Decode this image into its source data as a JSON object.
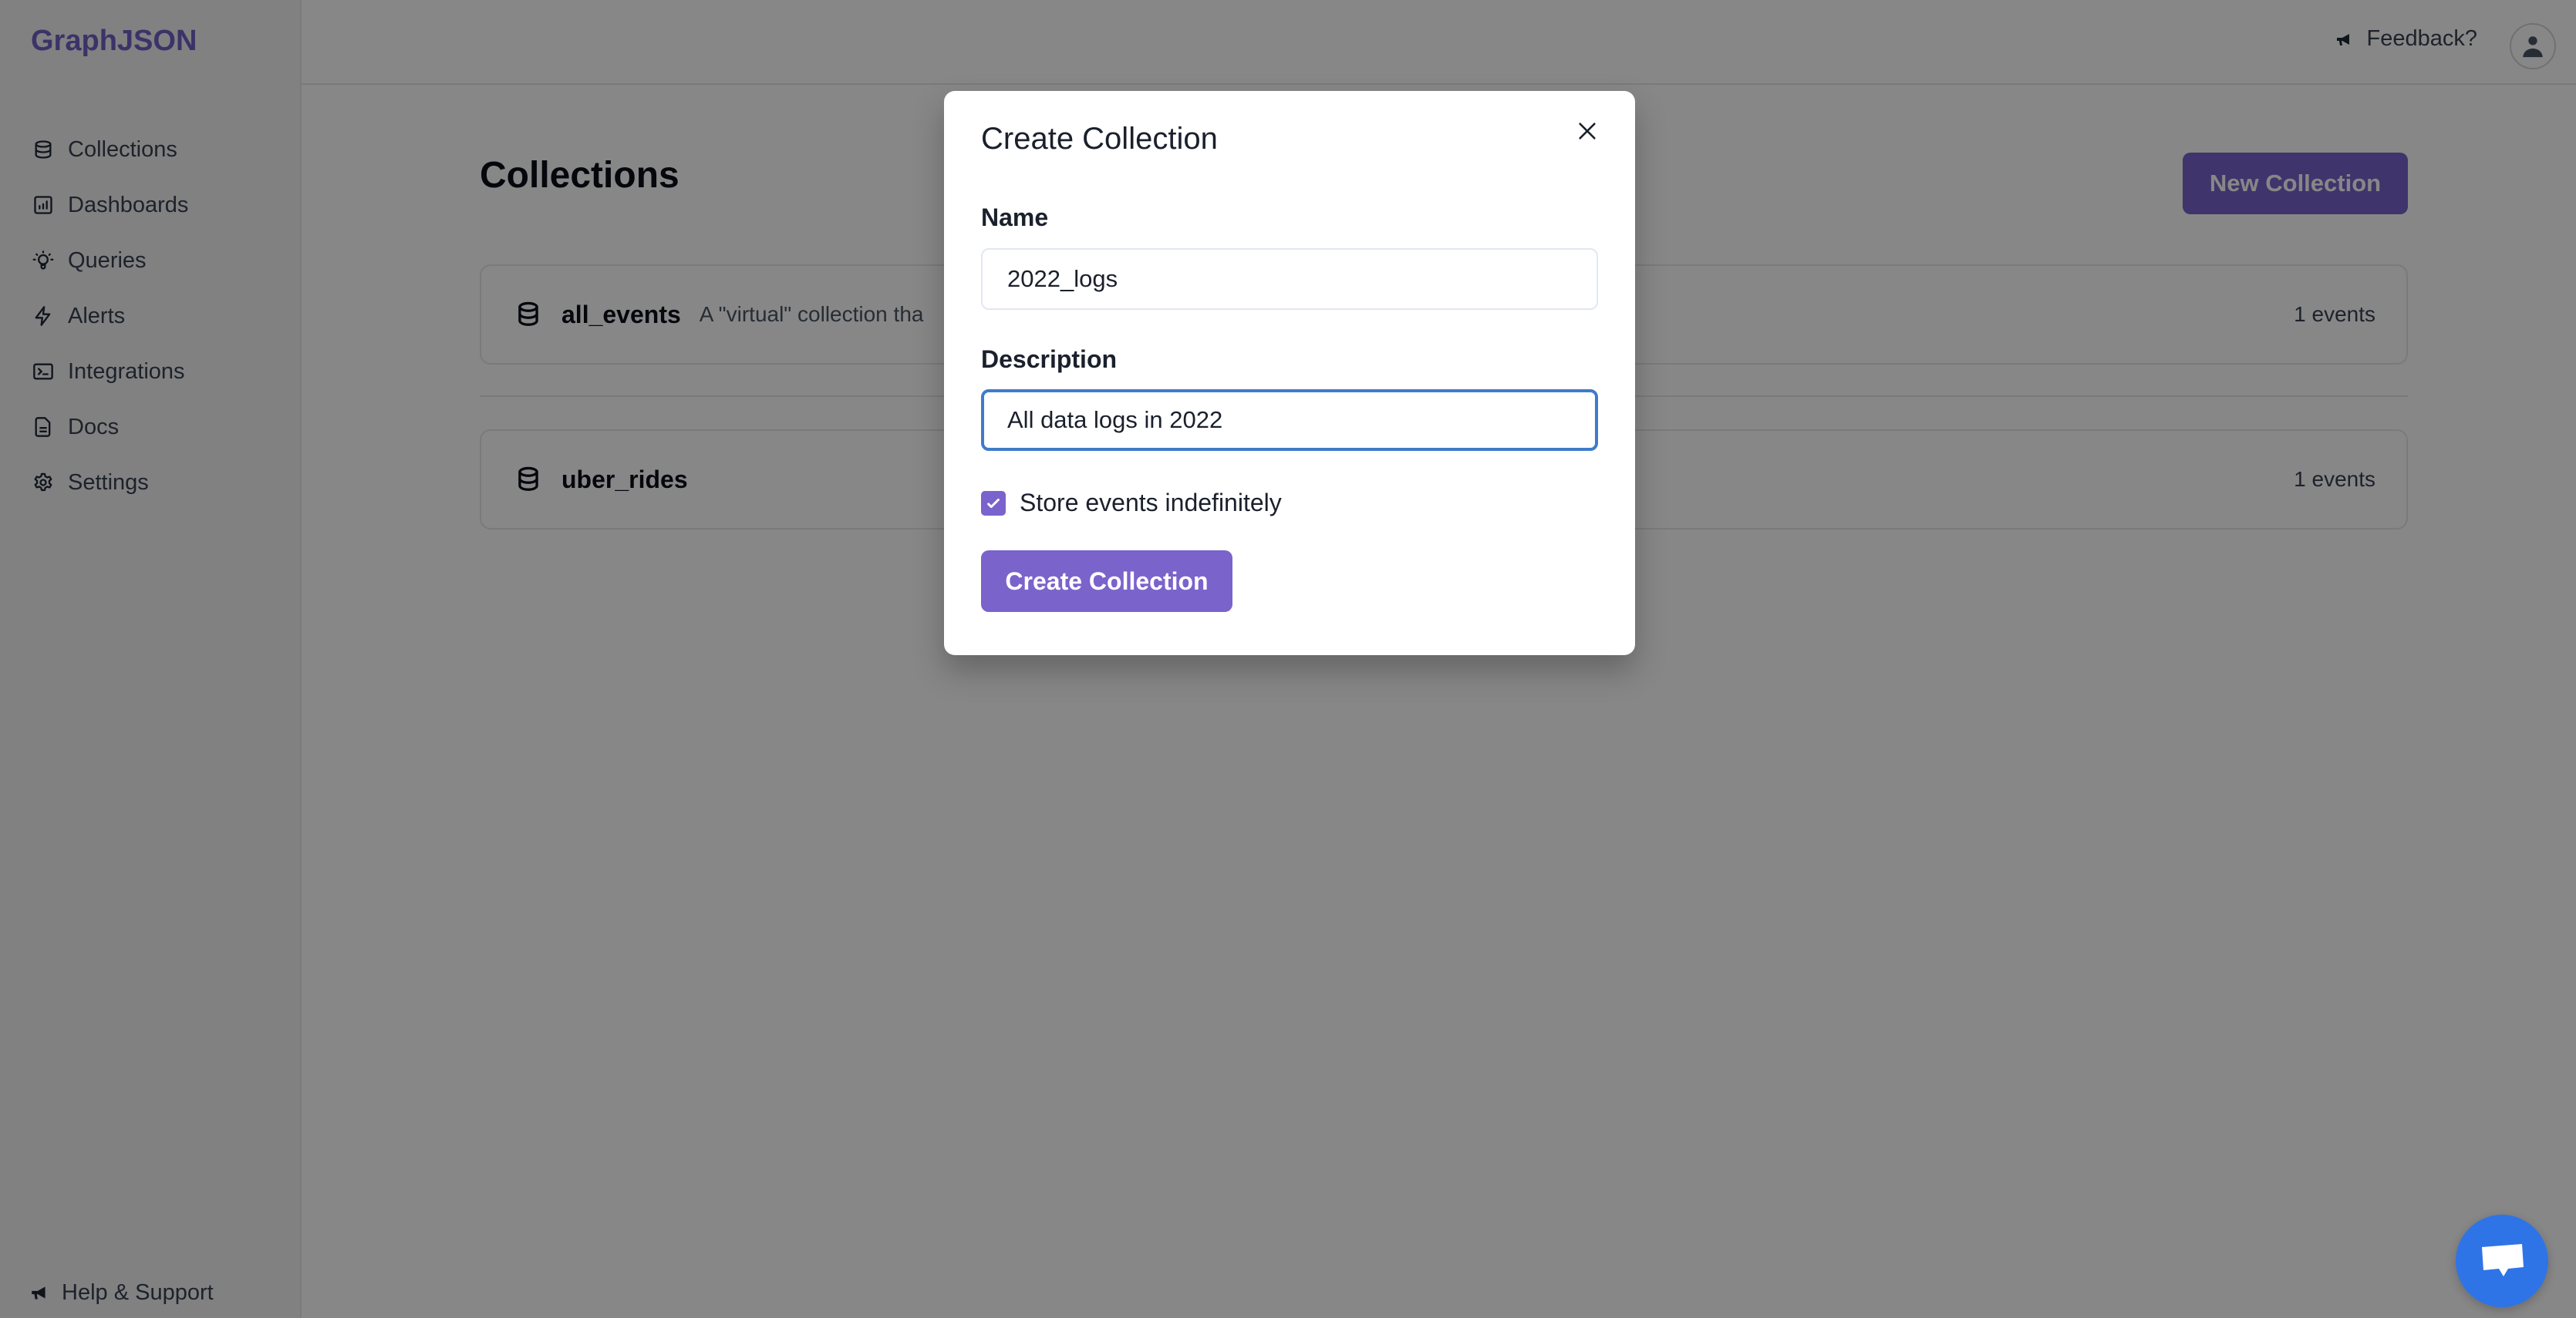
{
  "app": {
    "logo": "GraphJSON"
  },
  "sidebar": {
    "items": [
      {
        "label": "Collections",
        "icon": "database-icon"
      },
      {
        "label": "Dashboards",
        "icon": "chart-bar-icon"
      },
      {
        "label": "Queries",
        "icon": "lightbulb-icon"
      },
      {
        "label": "Alerts",
        "icon": "lightning-icon"
      },
      {
        "label": "Integrations",
        "icon": "terminal-icon"
      },
      {
        "label": "Docs",
        "icon": "document-icon"
      },
      {
        "label": "Settings",
        "icon": "gear-icon"
      }
    ],
    "help": {
      "label": "Help & Support",
      "icon": "megaphone-icon"
    }
  },
  "header": {
    "feedback_label": "Feedback?",
    "feedback_icon": "megaphone-icon",
    "avatar_icon": "user-icon"
  },
  "main": {
    "title": "Collections",
    "new_button_label": "New Collection",
    "collections": [
      {
        "name": "all_events",
        "description": "A \"virtual\" collection tha",
        "count": "1 events"
      },
      {
        "name": "uber_rides",
        "description": "",
        "count": "1 events"
      }
    ]
  },
  "modal": {
    "title": "Create Collection",
    "name_label": "Name",
    "name_value": "2022_logs",
    "description_label": "Description",
    "description_value": "All data logs in 2022",
    "checkbox_label": "Store events indefinitely",
    "checkbox_checked": true,
    "submit_label": "Create Collection"
  },
  "colors": {
    "accent": "#7a62cc",
    "focus_ring": "#3f7bc9",
    "chat_button": "#2f74e6"
  }
}
